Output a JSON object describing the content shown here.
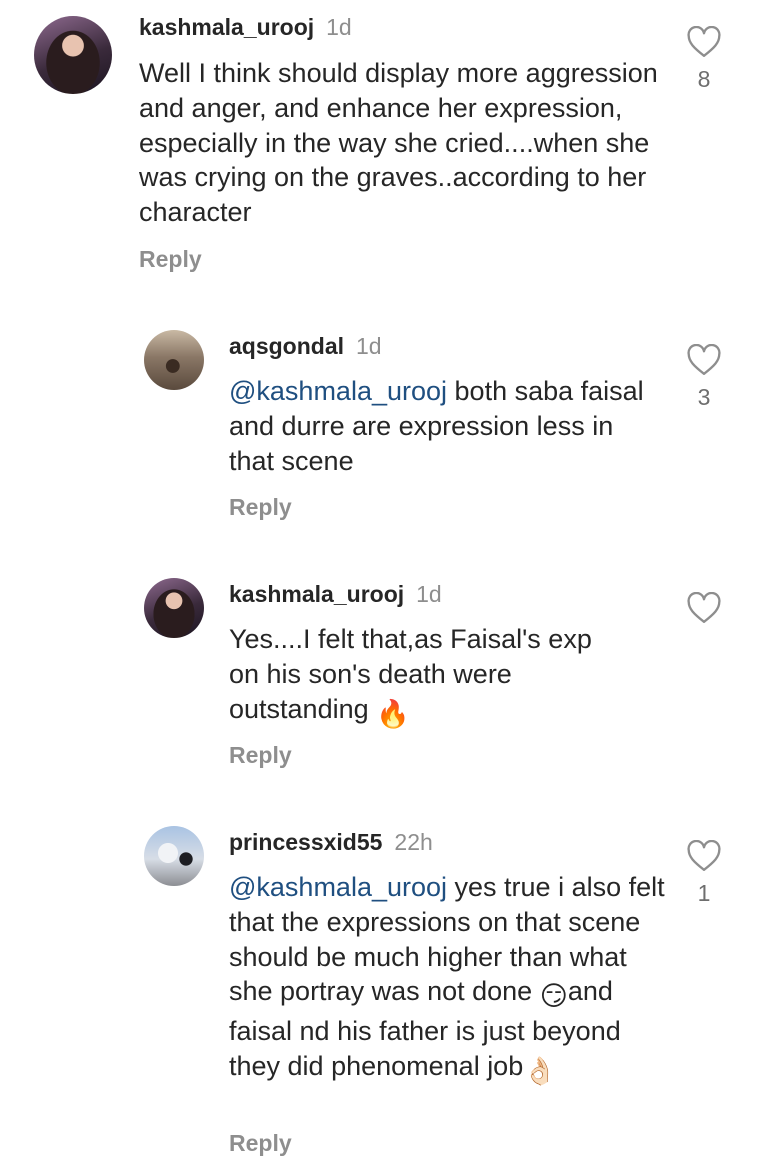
{
  "comments": [
    {
      "username": "kashmala_urooj",
      "time": "1d",
      "text": "Well I think  should display more aggression and anger, and enhance her expression, especially in the way she cried....when she was crying on the graves..according to her character",
      "reply": "Reply",
      "likes": "8",
      "icon": "heart-outline-icon"
    },
    {
      "username": "aqsgondal",
      "time": "1d",
      "mention": "@kashmala_urooj",
      "text": " both saba faisal and durre are expression less in that scene",
      "reply": "Reply",
      "likes": "3",
      "icon": "heart-outline-icon"
    },
    {
      "username": "kashmala_urooj",
      "time": "1d",
      "text": "Yes....I felt that,as Faisal's exp on his son's death were outstanding",
      "emoji": "🔥",
      "reply": "Reply",
      "icon": "heart-outline-icon"
    },
    {
      "username": "princessxid55",
      "time": "22h",
      "mention": "@kashmala_urooj",
      "text": " yes true i also felt that the expressions on that scene should be much higher than what she portray was not done",
      "emoji1": "😏",
      "text2": "and faisal nd his father is just beyond they did phenomenal job",
      "emoji2": "👌🏻",
      "reply": "Reply",
      "likes": "1",
      "icon": "heart-outline-icon"
    }
  ],
  "colors": {
    "text": "#262626",
    "muted": "#8e8e8e",
    "mention": "#1f4f80"
  }
}
